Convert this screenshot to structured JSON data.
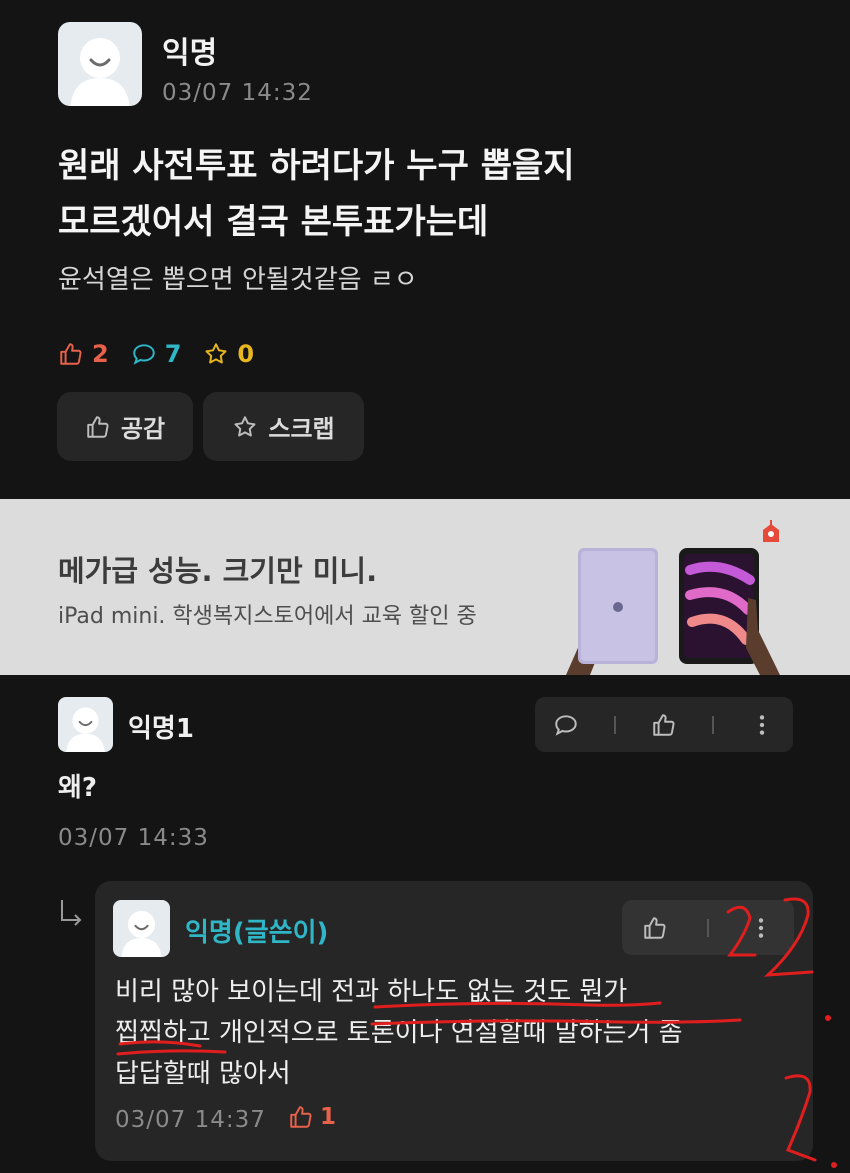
{
  "post": {
    "author": "익명",
    "time": "03/07 14:32",
    "title_line1": "원래 사전투표 하려다가 누구 뽑을지",
    "title_line2": "모르겠어서 결국 본투표가는데",
    "body": "윤석열은 뽑으면 안될것같음 ㄹㅇ",
    "stats": {
      "likes": "2",
      "comments": "7",
      "scraps": "0"
    },
    "buttons": {
      "like": "공감",
      "scrap": "스크랩"
    }
  },
  "ad": {
    "headline": "메가급 성능. 크기만 미니.",
    "subline": "iPad mini. 학생복지스토어에서 교육 할인 중"
  },
  "comment": {
    "author": "익명1",
    "text": "왜?",
    "time": "03/07 14:33"
  },
  "reply": {
    "author": "익명(글쓴이)",
    "line1": "비리 많아 보이는데 전과 하나도 없는 것도 뭔가",
    "line2": "찝찝하고 개인적으로 토론이나 연설할때 말하는거 좀",
    "line3": "답답할때 많아서",
    "time": "03/07 14:37",
    "likes": "1"
  },
  "colors": {
    "like": "#e8614a",
    "comment": "#2fb6c7",
    "scrap": "#e8b71f",
    "writer": "#2fb6c7",
    "annotation": "#e01e1e"
  },
  "icons": [
    "thumbs-up-icon",
    "speech-bubble-icon",
    "star-icon",
    "more-vertical-icon",
    "reply-arrow-icon"
  ]
}
